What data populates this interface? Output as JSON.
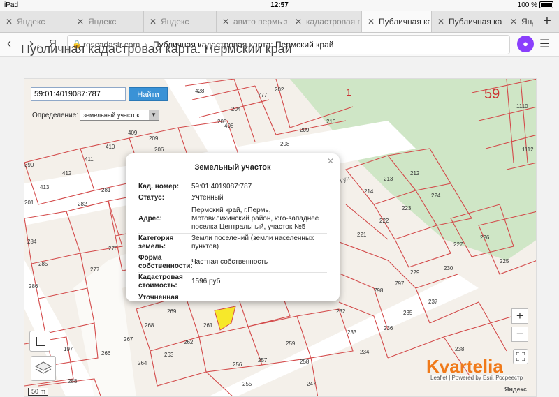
{
  "status_bar": {
    "device": "iPad",
    "time": "12:57",
    "battery": "100 %"
  },
  "tabs": [
    {
      "label": "Яндекс"
    },
    {
      "label": "Яндекс"
    },
    {
      "label": "Яндекс"
    },
    {
      "label": "авито пермь зе"
    },
    {
      "label": "кадастровая п"
    },
    {
      "label": "Публичная када"
    },
    {
      "label": "Публичная кадас"
    },
    {
      "label": "Янд"
    }
  ],
  "toolbar": {
    "back_icon": "‹",
    "forward_icon": "›",
    "yandex_icon": "Я",
    "url_host": "roscadastr.com",
    "url_separator": "›",
    "url_title": "Публичная кадастровая карта: Пермский край",
    "new_tab_icon": "+"
  },
  "page": {
    "heading": "Публичная кадастровая карта: Пермский край"
  },
  "search": {
    "value": "59:01:4019087:787",
    "button": "Найти",
    "definition_label": "Определение:",
    "definition_value": "земельный участок"
  },
  "popup": {
    "title": "Земельный участок",
    "rows": [
      {
        "key": "Кад. номер:",
        "value": "59:01:4019087:787"
      },
      {
        "key": "Статус:",
        "value": "Учтенный"
      },
      {
        "key": "Адрес:",
        "value": "Пермский край, г.Пермь, Мотовилихинский район, юго-западнее поселка Центральный, участок №5"
      },
      {
        "key": "Категория земель:",
        "value": "Земли поселений (земли населенных пунктов)"
      },
      {
        "key": "Форма собственности:",
        "value": "Частная собственность"
      },
      {
        "key": "Кадастровая стоимость:",
        "value": "1596 руб"
      },
      {
        "key": "Уточненная",
        "value": ""
      }
    ]
  },
  "map": {
    "zoom_in": "+",
    "zoom_out": "−",
    "brand": "Kvartelia",
    "attribution": "Leaflet | Powered by Esri, Росреестр",
    "yandex_mark": "Яндекс",
    "scale": "50 m",
    "region_1": "1",
    "region_59": "59",
    "street": "я ул.",
    "parcel_labels": [
      "428",
      "202",
      "204",
      "205",
      "777",
      "209",
      "210",
      "409",
      "408",
      "208",
      "390",
      "412",
      "411",
      "410",
      "413",
      "281",
      "213",
      "212",
      "214",
      "224",
      "282",
      "221",
      "223",
      "284",
      "276",
      "222",
      "227",
      "226",
      "285",
      "277",
      "225",
      "229",
      "286",
      "237",
      "232",
      "233",
      "236",
      "238",
      "234",
      "268",
      "267",
      "266",
      "262",
      "264",
      "263",
      "259",
      "256",
      "258",
      "257",
      "255",
      "247",
      "288",
      "197",
      "261",
      "269",
      "209",
      "206",
      "201",
      "1110",
      "1112",
      "798",
      "797",
      "230",
      "235"
    ],
    "colors": {
      "parcel_stroke": "#d34a4a",
      "selected_fill": "#f7e82a",
      "forest": "#cfe6c6",
      "road": "#ffffff"
    }
  }
}
